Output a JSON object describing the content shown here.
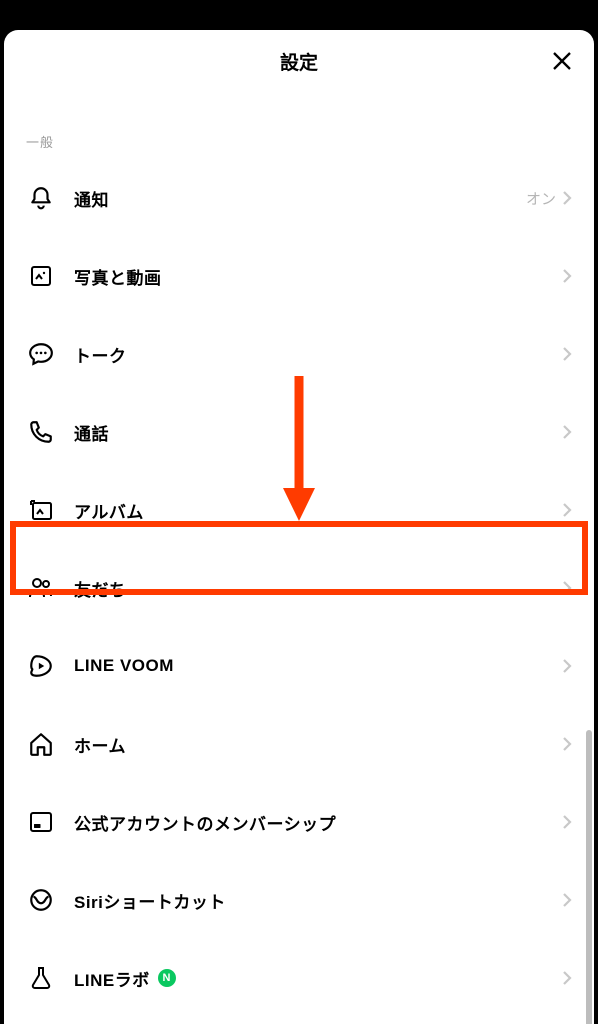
{
  "header": {
    "title": "設定"
  },
  "section": {
    "label": "一般"
  },
  "rows": [
    {
      "label": "通知",
      "value": "オン"
    },
    {
      "label": "写真と動画"
    },
    {
      "label": "トーク"
    },
    {
      "label": "通話"
    },
    {
      "label": "アルバム"
    },
    {
      "label": "友だち"
    },
    {
      "label": "LINE VOOM"
    },
    {
      "label": "ホーム"
    },
    {
      "label": "公式アカウントのメンバーシップ"
    },
    {
      "label": "Siriショートカット"
    },
    {
      "label": "LINEラボ",
      "badge": "N"
    }
  ]
}
